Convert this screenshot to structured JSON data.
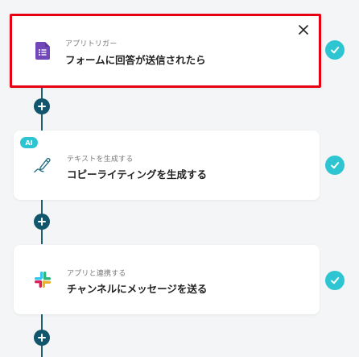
{
  "flow": {
    "steps": [
      {
        "category": "アプリトリガー",
        "title": "フォームに回答が送信されたら",
        "icon": "google-forms-icon",
        "selected": true,
        "completed": true
      },
      {
        "category": "テキストを生成する",
        "title": "コピーライティングを生成する",
        "icon": "pen-icon",
        "badge": "AI",
        "completed": true
      },
      {
        "category": "アプリと連携する",
        "title": "チャンネルにメッセージを送る",
        "icon": "slack-icon",
        "completed": true
      }
    ]
  },
  "colors": {
    "accent": "#2ec5d3",
    "connector": "#12566d",
    "selected_border": "#e60012",
    "forms_purple": "#7248b9"
  }
}
